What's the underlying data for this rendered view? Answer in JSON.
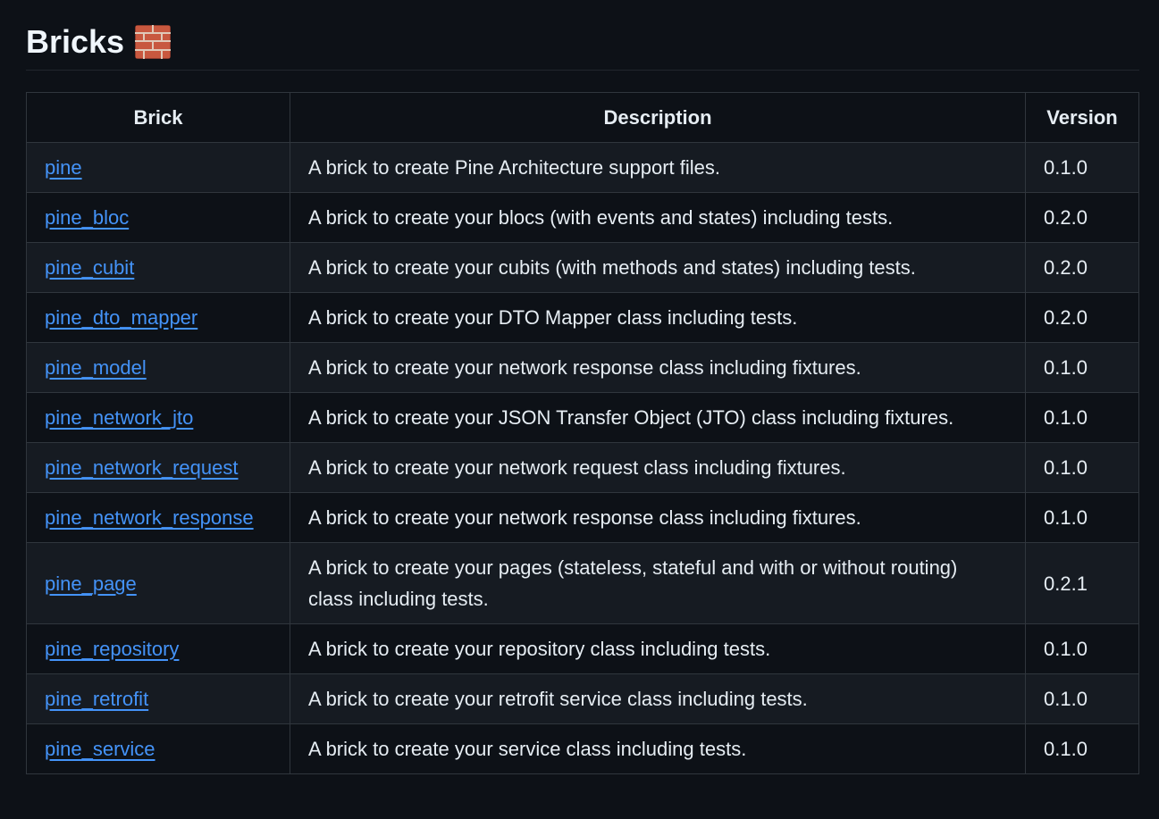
{
  "heading": {
    "title": "Bricks",
    "icon": "brick-wall-icon"
  },
  "table": {
    "headers": [
      "Brick",
      "Description",
      "Version"
    ],
    "rows": [
      {
        "brick": "pine",
        "description": "A brick to create Pine Architecture support files.",
        "version": "0.1.0"
      },
      {
        "brick": "pine_bloc",
        "description": "A brick to create your blocs (with events and states) including tests.",
        "version": "0.2.0"
      },
      {
        "brick": "pine_cubit",
        "description": "A brick to create your cubits (with methods and states) including tests.",
        "version": "0.2.0"
      },
      {
        "brick": "pine_dto_mapper",
        "description": "A brick to create your DTO Mapper class including tests.",
        "version": "0.2.0"
      },
      {
        "brick": "pine_model",
        "description": "A brick to create your network response class including fixtures.",
        "version": "0.1.0"
      },
      {
        "brick": "pine_network_jto",
        "description": "A brick to create your JSON Transfer Object (JTO) class including fixtures.",
        "version": "0.1.0"
      },
      {
        "brick": "pine_network_request",
        "description": "A brick to create your network request class including fixtures.",
        "version": "0.1.0"
      },
      {
        "brick": "pine_network_response",
        "description": "A brick to create your network response class including fixtures.",
        "version": "0.1.0"
      },
      {
        "brick": "pine_page",
        "description": "A brick to create your pages (stateless, stateful and with or without routing) class including tests.",
        "version": "0.2.1"
      },
      {
        "brick": "pine_repository",
        "description": "A brick to create your repository class including tests.",
        "version": "0.1.0"
      },
      {
        "brick": "pine_retrofit",
        "description": "A brick to create your retrofit service class including tests.",
        "version": "0.1.0"
      },
      {
        "brick": "pine_service",
        "description": "A brick to create your service class including tests.",
        "version": "0.1.0"
      }
    ]
  },
  "colors": {
    "background": "#0d1117",
    "row_alt": "#161b22",
    "border": "#30363d",
    "link": "#4493f8",
    "text": "#e6edf3"
  }
}
